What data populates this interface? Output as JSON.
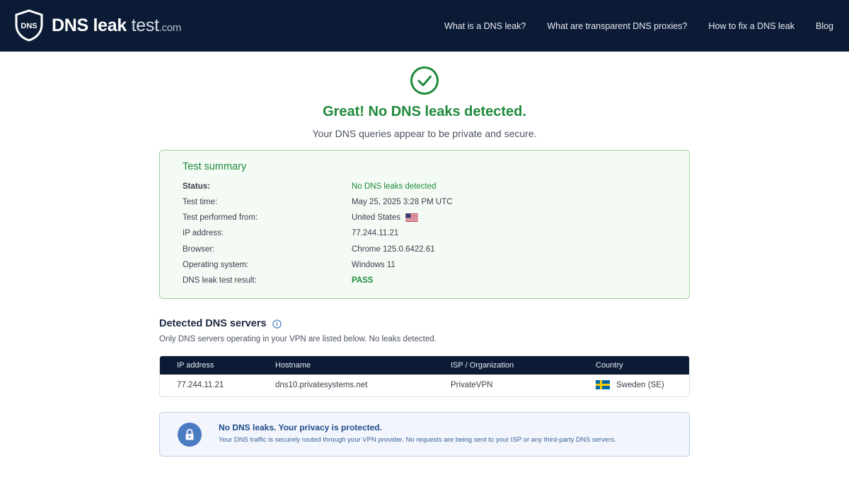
{
  "header": {
    "logo": {
      "dns": "DNS leak",
      "test": " test",
      "com": ".com",
      "shield_text": "DNS"
    },
    "nav": [
      {
        "label": "What is a DNS leak?"
      },
      {
        "label": "What are transparent DNS proxies?"
      },
      {
        "label": "How to fix a DNS leak"
      },
      {
        "label": "Blog"
      }
    ]
  },
  "hero": {
    "title": "Great! No DNS leaks detected.",
    "subtitle": "Your DNS queries appear to be private and secure."
  },
  "summary": {
    "title": "Test summary",
    "rows": [
      {
        "key": "Status:",
        "value": "No DNS leaks detected"
      },
      {
        "key": "Test time:",
        "value": "May 25, 2025 3:28 PM UTC"
      },
      {
        "key": "Test performed from:",
        "value": "United States"
      },
      {
        "key": "IP address:",
        "value": "77.244.11.21"
      },
      {
        "key": "Browser:",
        "value": "Chrome 125.0.6422.61"
      },
      {
        "key": "Operating system:",
        "value": "Windows 11"
      },
      {
        "key": "DNS leak test result:",
        "value": "PASS"
      }
    ]
  },
  "servers": {
    "title": "Detected DNS servers",
    "subtitle": "Only DNS servers operating in your VPN are listed below. No leaks detected.",
    "columns": [
      "IP address",
      "Hostname",
      "ISP / Organization",
      "Country"
    ],
    "rows": [
      {
        "ip": "77.244.11.21",
        "hostname": "dns10.privatesystems.net",
        "isp": "PrivateVPN",
        "country": "Sweden (SE)"
      }
    ]
  },
  "banner": {
    "title": "No DNS leaks. Your privacy is protected.",
    "text": "Your DNS traffic is securely routed through your VPN provider. No requests are being sent to your ISP or any third-party DNS servers."
  },
  "colors": {
    "header_bg": "#0c1b35",
    "success_green": "#1f8a3b",
    "info_blue": "#1f4a8c"
  },
  "icons": [
    "shield-logo-icon",
    "check-circle-icon",
    "us-flag-icon",
    "info-icon",
    "sweden-flag-icon",
    "lock-icon"
  ]
}
